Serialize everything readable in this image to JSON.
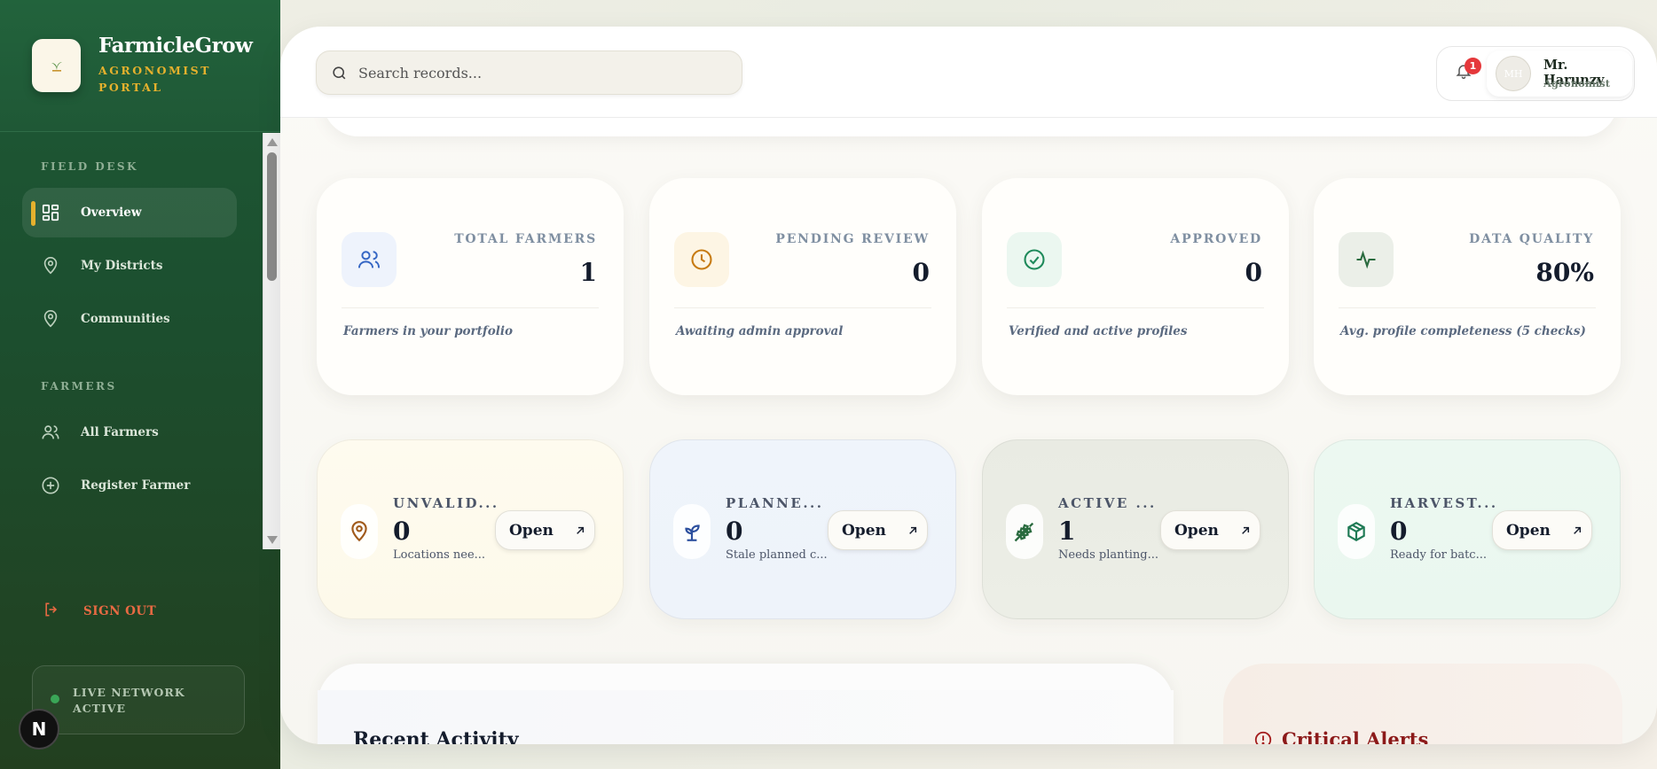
{
  "brand": {
    "name": "FarmicleGrow",
    "subtitle": "AGRONOMIST PORTAL"
  },
  "sidebar": {
    "sections": [
      {
        "title": "FIELD DESK"
      },
      {
        "title": "FARMERS"
      }
    ],
    "items": [
      {
        "label": "Overview",
        "icon": "grid-icon",
        "active": true
      },
      {
        "label": "My Districts",
        "icon": "map-pin-icon"
      },
      {
        "label": "Communities",
        "icon": "map-pin-icon"
      },
      {
        "label": "All Farmers",
        "icon": "users-icon"
      },
      {
        "label": "Register Farmer",
        "icon": "plus-circle-icon"
      }
    ],
    "sign_out": "SIGN OUT",
    "status": "LIVE NETWORK ACTIVE",
    "badge": "N"
  },
  "header": {
    "search_placeholder": "Search records...",
    "notification_count": "1",
    "user": {
      "name": "Mr. Harunzy",
      "role": "Agronomist",
      "initials": "MH"
    }
  },
  "stats": [
    {
      "label": "TOTAL FARMERS",
      "value": "1",
      "note": "Farmers in your portfolio",
      "icon": "users-icon",
      "color": "#3566c4",
      "bg": "#eef3fc"
    },
    {
      "label": "PENDING REVIEW",
      "value": "0",
      "note": "Awaiting admin approval",
      "icon": "clock-icon",
      "color": "#c77b12",
      "bg": "#fdf5e4"
    },
    {
      "label": "APPROVED",
      "value": "0",
      "note": "Verified and active profiles",
      "icon": "check-circle-icon",
      "color": "#1f8a5b",
      "bg": "#ebf7f0"
    },
    {
      "label": "DATA QUALITY",
      "value": "80%",
      "note": "Avg. profile completeness (5 checks)",
      "icon": "activity-icon",
      "color": "#2a6b3f",
      "bg": "#ebefe8"
    }
  ],
  "queues": [
    {
      "title": "UNVALID...",
      "value": "0",
      "desc": "Locations nee...",
      "button": "Open",
      "icon": "map-pin-icon",
      "color": "#a05a1b",
      "bg": "#fefbef"
    },
    {
      "title": "PLANNE...",
      "value": "0",
      "desc": "Stale planned c...",
      "button": "Open",
      "icon": "sprout-icon",
      "color": "#2c4f9e",
      "bg": "#eff4fb"
    },
    {
      "title": "ACTIVE ...",
      "value": "1",
      "desc": "Needs planting...",
      "button": "Open",
      "icon": "wheat-icon",
      "color": "#2a6b3f",
      "bg": "#eceee6"
    },
    {
      "title": "HARVEST...",
      "value": "0",
      "desc": "Ready for batc...",
      "button": "Open",
      "icon": "package-icon",
      "color": "#1f7a55",
      "bg": "#ecf8f1"
    }
  ],
  "panels": {
    "activity_title": "Recent Activity",
    "alerts_title": "Critical Alerts"
  }
}
